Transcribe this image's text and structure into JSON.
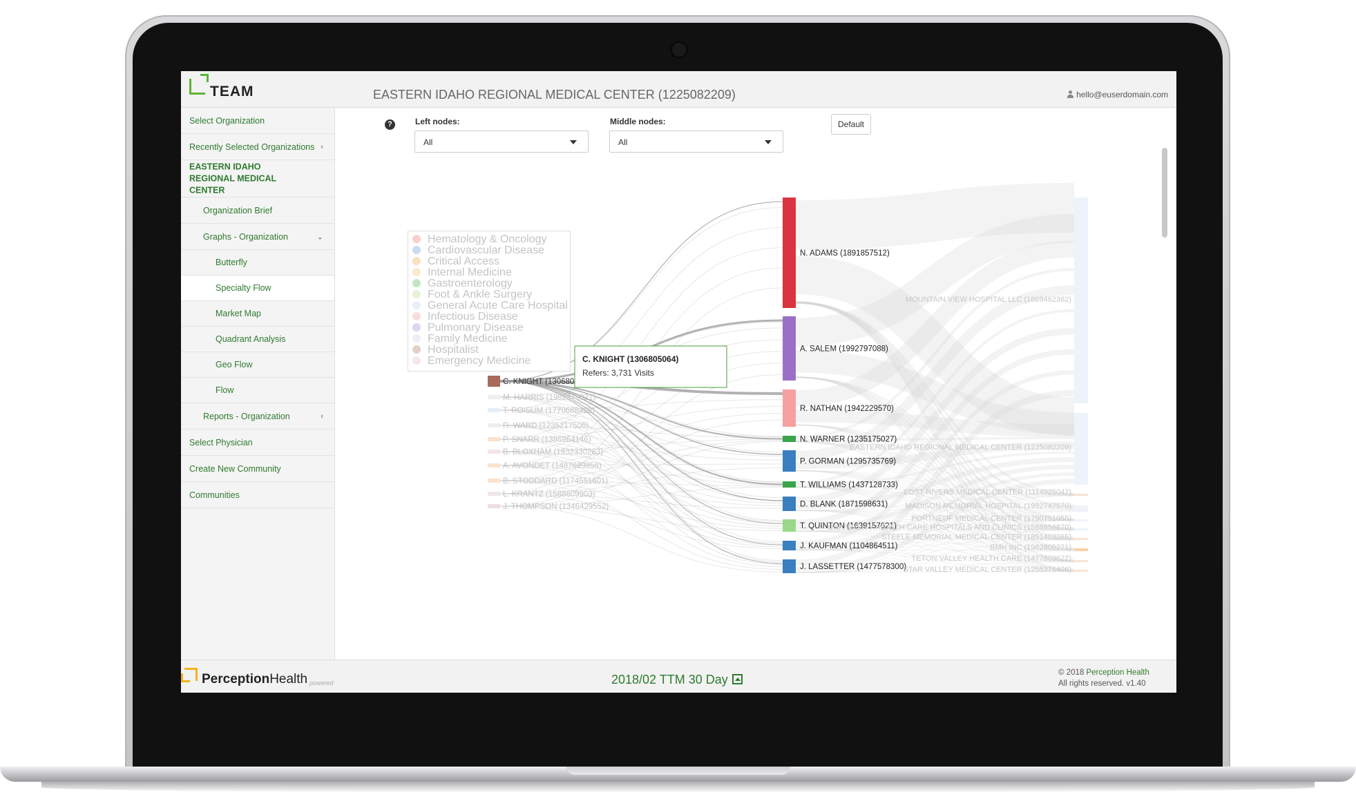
{
  "app": {
    "logo_text": "TEAM",
    "page_title": "EASTERN IDAHO REGIONAL MEDICAL CENTER (1225082209)",
    "user_email": "hello@euserdomain.com",
    "colors": {
      "brand_green": "#2f7a2f",
      "accent_green": "#5fb336",
      "brand_yellow": "#f2b21b"
    }
  },
  "sidebar": {
    "items": [
      {
        "label": "Select Organization",
        "icon": "",
        "indent": 0
      },
      {
        "label": "Recently Selected Organizations",
        "icon": "chevron-left-icon",
        "indent": 0
      },
      {
        "label": "EASTERN IDAHO REGIONAL MEDICAL CENTER",
        "icon": "",
        "indent": 0
      },
      {
        "label": "Organization Brief",
        "icon": "",
        "indent": 1
      },
      {
        "label": "Graphs - Organization",
        "icon": "chevron-down-icon",
        "indent": 1
      },
      {
        "label": "Butterfly",
        "icon": "",
        "indent": 2
      },
      {
        "label": "Specialty Flow",
        "icon": "",
        "indent": 2
      },
      {
        "label": "Market Map",
        "icon": "",
        "indent": 2
      },
      {
        "label": "Quadrant Analysis",
        "icon": "",
        "indent": 2
      },
      {
        "label": "Geo Flow",
        "icon": "",
        "indent": 2
      },
      {
        "label": "Flow",
        "icon": "",
        "indent": 2
      },
      {
        "label": "Reports - Organization",
        "icon": "chevron-left-icon",
        "indent": 1
      },
      {
        "label": "Select Physician",
        "icon": "",
        "indent": 0
      },
      {
        "label": "Create New Community",
        "icon": "",
        "indent": 0
      },
      {
        "label": "Communities",
        "icon": "",
        "indent": 0
      }
    ],
    "active": "Specialty Flow"
  },
  "filters": {
    "help": "?",
    "left_label": "Left nodes:",
    "left_value": "All",
    "middle_label": "Middle nodes:",
    "middle_value": "All",
    "default_button": "Default"
  },
  "legend": [
    {
      "label": "Hematology & Oncology",
      "color": "#f4a7a7"
    },
    {
      "label": "Cardiovascular Disease",
      "color": "#9fbde8"
    },
    {
      "label": "Critical Access",
      "color": "#f7c48f"
    },
    {
      "label": "Internal Medicine",
      "color": "#f7d9a8"
    },
    {
      "label": "Gastroenterology",
      "color": "#8fd18f"
    },
    {
      "label": "Foot & Ankle Surgery",
      "color": "#cfe8b8"
    },
    {
      "label": "General Acute Care Hospital",
      "color": "#d6e3f5"
    },
    {
      "label": "Infectious Disease",
      "color": "#f7c0c0"
    },
    {
      "label": "Pulmonary Disease",
      "color": "#c8b0e0"
    },
    {
      "label": "Family Medicine",
      "color": "#e6ddef"
    },
    {
      "label": "Hospitalist",
      "color": "#c9a79a"
    },
    {
      "label": "Emergency Medicine",
      "color": "#f0d6d6"
    }
  ],
  "chart_data": {
    "type": "sankey",
    "left_nodes": [
      {
        "label": "C. KNIGHT (1306805064)",
        "color": "#a86a5a",
        "highlight": true
      },
      {
        "label": "M. HARRIS (1952579021)",
        "color": "#eeeeee"
      },
      {
        "label": "T. ROISUM (1770688428)",
        "color": "#e6eef8"
      },
      {
        "label": "R. WARD (1235217506)",
        "color": "#eeeeee"
      },
      {
        "label": "P. SNARR (1386964146)",
        "color": "#fbe3cf"
      },
      {
        "label": "B. BLOXHAM (1932330263)",
        "color": "#f4e4ea"
      },
      {
        "label": "A. AVONDET (1487699856)",
        "color": "#fbe3cf"
      },
      {
        "label": "B. STODDARD (1174551601)",
        "color": "#fbe3cf"
      },
      {
        "label": "L. KRANTZ (1588609903)",
        "color": "#f0e6ea"
      },
      {
        "label": "J. THOMPSON (1346429552)",
        "color": "#eee0e0"
      }
    ],
    "middle_nodes": [
      {
        "label": "N. ADAMS (1891857512)",
        "color": "#d9343f"
      },
      {
        "label": "A. SALEM (1992797088)",
        "color": "#9b6fc5"
      },
      {
        "label": "R. NATHAN (1942229570)",
        "color": "#f6a0a0"
      },
      {
        "label": "N. WARNER (1235175027)",
        "color": "#3aa54a"
      },
      {
        "label": "P. GORMAN (1295735769)",
        "color": "#3a7fc0"
      },
      {
        "label": "T. WILLIAMS (1437128733)",
        "color": "#3aa54a"
      },
      {
        "label": "D. BLANK (1871598631)",
        "color": "#3a7fc0"
      },
      {
        "label": "T. QUINTON (1639157621)",
        "color": "#9ad98c"
      },
      {
        "label": "J. KAUFMAN (1104864511)",
        "color": "#3a7fc0"
      },
      {
        "label": "J. LASSETTER (1477578300)",
        "color": "#3a7fc0"
      }
    ],
    "right_nodes": [
      {
        "label": "MOUNTAIN VIEW HOSPITAL LLC (1669462362)",
        "color": "#eef3fb"
      },
      {
        "label": "EASTERN IDAHO REGIONAL MEDICAL CENTER (1225082209)",
        "color": "#eef3fb"
      },
      {
        "label": "LOST RIVERS MEDICAL CENTER (1114925047)",
        "color": "#fbe3cf"
      },
      {
        "label": "MADISON MEMORIAL HOSPITAL (1992747570)",
        "color": "#eef3fb"
      },
      {
        "label": "PORTNEUF MEDICAL CENTER (1790751055)",
        "color": "#eef3fb"
      },
      {
        "label": "UNIVERSITY HEALTH CARE HOSPITALS AND CLINICS (1588656870)",
        "color": "#eef3fb"
      },
      {
        "label": "STEELE MEMORIAL MEDICAL CENTER (1851403265)",
        "color": "#fbe3cf"
      },
      {
        "label": "BMH INC (1982805271)",
        "color": "#fbd0a8"
      },
      {
        "label": "TETON VALLEY HEALTH CARE (1477809622)",
        "color": "#fbe3cf"
      },
      {
        "label": "STAR VALLEY MEDICAL CENTER (1255376406)",
        "color": "#fbe3cf"
      }
    ],
    "tooltip": {
      "title": "C. KNIGHT (1306805064)",
      "text": "Refers: 3,731 Visits",
      "visits": 3731
    }
  },
  "footer": {
    "brand_bold": "Perception",
    "brand_light": "Health",
    "powered": "powered",
    "period": "2018/02 TTM 30 Day",
    "copyright_prefix": "© 2018 ",
    "copyright_brand": "Perception Health",
    "rights": "All rights reserved. v1.40"
  }
}
